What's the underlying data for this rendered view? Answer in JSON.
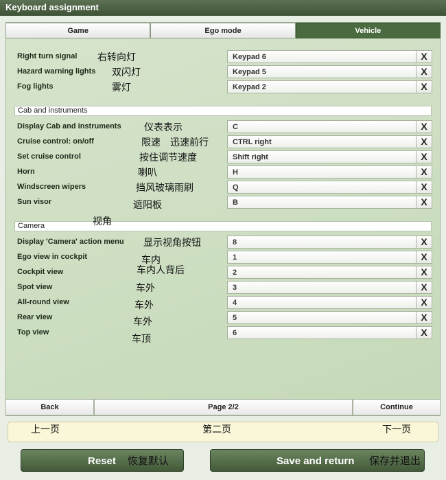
{
  "window": {
    "title": "Keyboard assignment"
  },
  "tabs": [
    "Game",
    "Ego mode",
    "Vehicle"
  ],
  "rows_top": [
    {
      "label": "Right turn signal",
      "cn": "右转向灯",
      "key": "Keypad 6"
    },
    {
      "label": "Hazard warning lights",
      "cn": "双闪灯",
      "key": "Keypad 5"
    },
    {
      "label": "Fog lights",
      "cn": "雾灯",
      "key": "Keypad 2"
    }
  ],
  "section_cab": {
    "title": "Cab and instruments"
  },
  "rows_cab": [
    {
      "label": "Display Cab and instruments",
      "cn": "仪表表示",
      "key": "C"
    },
    {
      "label": "Cruise control: on/off",
      "cn": "限速　迅速前行",
      "key": "CTRL right"
    },
    {
      "label": "Set cruise control",
      "cn": "按住调节速度",
      "key": "Shift right"
    },
    {
      "label": "Horn",
      "cn": "喇叭",
      "key": "H"
    },
    {
      "label": "Windscreen wipers",
      "cn": "挡风玻璃雨刷",
      "key": "Q"
    },
    {
      "label": "Sun visor",
      "cn": "遮阳板",
      "key": "B"
    }
  ],
  "section_camera": {
    "title": "Camera",
    "cn": "视角"
  },
  "rows_camera": [
    {
      "label": "Display 'Camera' action menu",
      "cn": "显示视角按钮",
      "key": "8"
    },
    {
      "label": "Ego view in cockpit",
      "cn": "车内",
      "key": "1"
    },
    {
      "label": "Cockpit view",
      "cn": "车内人背后",
      "key": "2"
    },
    {
      "label": "Spot view",
      "cn": "车外",
      "key": "3"
    },
    {
      "label": "All-round view",
      "cn": "车外",
      "key": "4"
    },
    {
      "label": "Rear view",
      "cn": "车外",
      "key": "5"
    },
    {
      "label": "Top view",
      "cn": "车顶",
      "key": "6"
    }
  ],
  "clear_glyph": "X",
  "nav": {
    "back": "Back",
    "page": "Page 2/2",
    "continue": "Continue"
  },
  "hints": {
    "back_cn": "上一页",
    "page_cn": "第二页",
    "continue_cn": "下一页"
  },
  "buttons": {
    "reset": "Reset",
    "reset_cn": "恢复默认",
    "save": "Save and return",
    "save_cn": "保存并退出"
  },
  "colors": {
    "title_bar": "#4a5e41",
    "accent_tab": "#4a6a3f",
    "panel": "#cfe0c6",
    "hint_bg": "#faf7d9"
  }
}
